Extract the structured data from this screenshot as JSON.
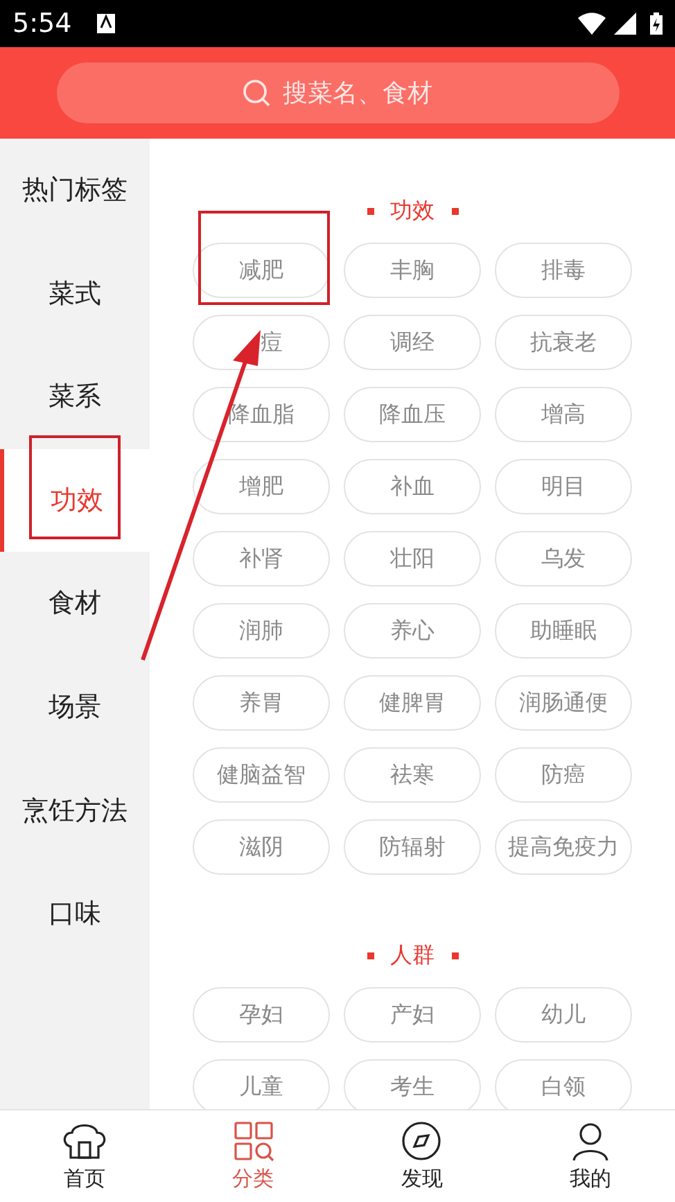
{
  "status_bar": {
    "time": "5:54"
  },
  "search": {
    "placeholder": "搜菜名、食材"
  },
  "sidebar": {
    "items": [
      {
        "label": "热门标签",
        "selected": false
      },
      {
        "label": "菜式",
        "selected": false
      },
      {
        "label": "菜系",
        "selected": false
      },
      {
        "label": "功效",
        "selected": true
      },
      {
        "label": "食材",
        "selected": false
      },
      {
        "label": "场景",
        "selected": false
      },
      {
        "label": "烹饪方法",
        "selected": false
      },
      {
        "label": "口味",
        "selected": false
      }
    ]
  },
  "sections": [
    {
      "title": "功效",
      "tags": [
        "减肥",
        "丰胸",
        "排毒",
        {
          "label": "痘",
          "kind": "covered"
        },
        "调经",
        "抗衰老",
        "降血脂",
        "降血压",
        "增高",
        "增肥",
        "补血",
        "明目",
        "补肾",
        "壮阳",
        "乌发",
        "润肺",
        "养心",
        "助睡眠",
        "养胃",
        "健脾胃",
        "润肠通便",
        "健脑益智",
        "祛寒",
        "防癌",
        "滋阴",
        "防辐射",
        "提高免疫力"
      ]
    },
    {
      "title": "人群",
      "tags": [
        "孕妇",
        "产妇",
        "幼儿",
        "儿童",
        "考生",
        "白领"
      ]
    }
  ],
  "bottom_nav": [
    {
      "label": "首页",
      "kind": "home",
      "selected": false
    },
    {
      "label": "分类",
      "kind": "category",
      "selected": true
    },
    {
      "label": "发现",
      "kind": "discover",
      "selected": false
    },
    {
      "label": "我的",
      "kind": "profile",
      "selected": false
    }
  ]
}
